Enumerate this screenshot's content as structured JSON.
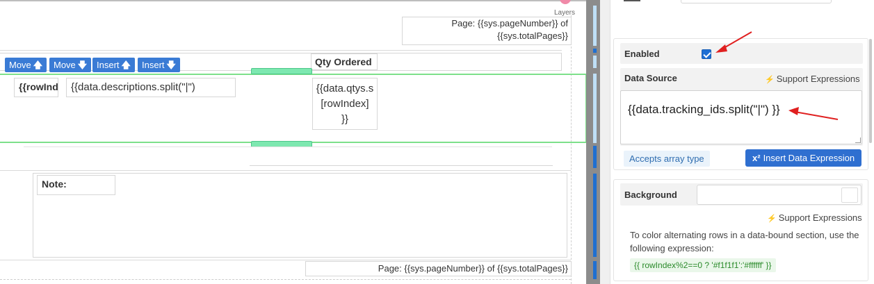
{
  "canvas": {
    "layers_label": "Layers",
    "header_page_text_line1": "Page: {{sys.pageNumber}} of",
    "header_page_text_line2": "{{sys.totalPages}}",
    "toolbar": {
      "move_up": "Move",
      "move_down": "Move",
      "insert_up": "Insert",
      "insert_down": "Insert"
    },
    "qty_header": "Qty Ordered",
    "row_index_cell": "{{rowInd",
    "descriptions_cell": "{{data.descriptions.split(\"|\")",
    "qtys_cell_line1": "{{data.qtys.s",
    "qtys_cell_line2": "[rowIndex]",
    "qtys_cell_line3": "}}",
    "note_label": "Note:",
    "footer_page_text": "Page: {{sys.pageNumber}} of {{sys.totalPages}}"
  },
  "panel": {
    "enabled_label": "Enabled",
    "enabled_checked": true,
    "data_source_label": "Data Source",
    "support_expressions": "Support Expressions",
    "data_source_value": "{{data.tracking_ids.split(\"|\") }}",
    "accepts_array": "Accepts array type",
    "insert_data_expression": "Insert Data Expression",
    "insert_icon": "x²",
    "background_label": "Background",
    "background_support": "Support Expressions",
    "help_text_line1": "To color alternating rows in a data-bound section, use the",
    "help_text_line2": "following expression:",
    "code_example": "{{ rowIndex%2==0 ? '#f1f1f1':'#ffffff' }}"
  },
  "icons": {
    "arrow_up": "arrow-up-icon",
    "arrow_down": "arrow-down-icon",
    "bolt": "bolt-icon",
    "red_arrow": "annotation-arrow-icon"
  },
  "colors": {
    "primary_blue": "#3a7bd5",
    "selection_green": "#7de08a",
    "annotation_red": "#e02020"
  }
}
